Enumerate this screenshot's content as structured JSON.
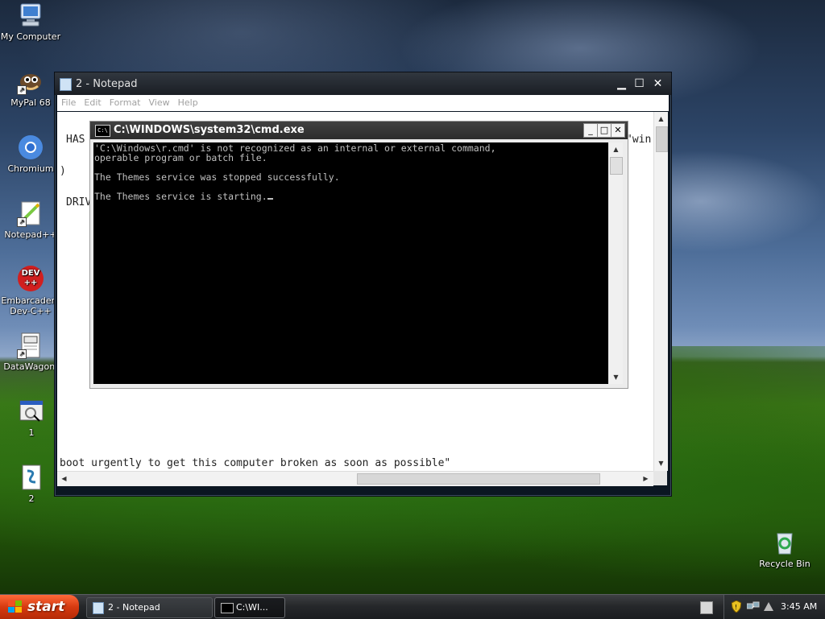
{
  "desktop": {
    "icons": [
      {
        "label": "My Computer",
        "icon": "computer-icon"
      },
      {
        "label": "MyPal 68",
        "icon": "mypal-browser-icon"
      },
      {
        "label": "Chromium",
        "icon": "chromium-icon"
      },
      {
        "label": "Notepad++",
        "icon": "notepadpp-icon"
      },
      {
        "label": "Embarcadero Dev-C++",
        "icon": "devcpp-icon",
        "badge": "DEV ++"
      },
      {
        "label": "DataWagon.",
        "icon": "datawagon-icon"
      },
      {
        "label": "1",
        "icon": "program-shortcut-icon"
      },
      {
        "label": "2",
        "icon": "script-file-icon"
      },
      {
        "label": "Recycle Bin",
        "icon": "recycle-bin-icon"
      }
    ]
  },
  "notepad": {
    "title": "2 - Notepad",
    "menu": [
      "File",
      "Edit",
      "Format",
      "View",
      "Help"
    ],
    "text_lines": {
      "has": "HAS",
      "win": "\"win",
      "paren": ")",
      "driv": "DRIV",
      "boot": "boot urgently to get this computer broken as soon as possible\""
    }
  },
  "cmd": {
    "title": "C:\\WINDOWS\\system32\\cmd.exe",
    "icon_text": "C:\\",
    "lines": [
      "'C:\\Windows\\r.cmd' is not recognized as an internal or external command,",
      "operable program or batch file.",
      "",
      "The Themes service was stopped successfully.",
      "",
      "The Themes service is starting."
    ]
  },
  "taskbar": {
    "start_label": "start",
    "tasks": [
      {
        "label": "2 - Notepad",
        "icon": "notepad-icon"
      },
      {
        "label": "C:\\WI...",
        "icon": "cmd-icon"
      }
    ],
    "tray_icons": [
      "language-bar-icon",
      "security-shield-icon",
      "network-icon"
    ],
    "clock": "3:45 AM"
  },
  "colors": {
    "start_button": "#d63a10",
    "console_bg": "#000000",
    "console_fg": "#c0c0c0"
  }
}
